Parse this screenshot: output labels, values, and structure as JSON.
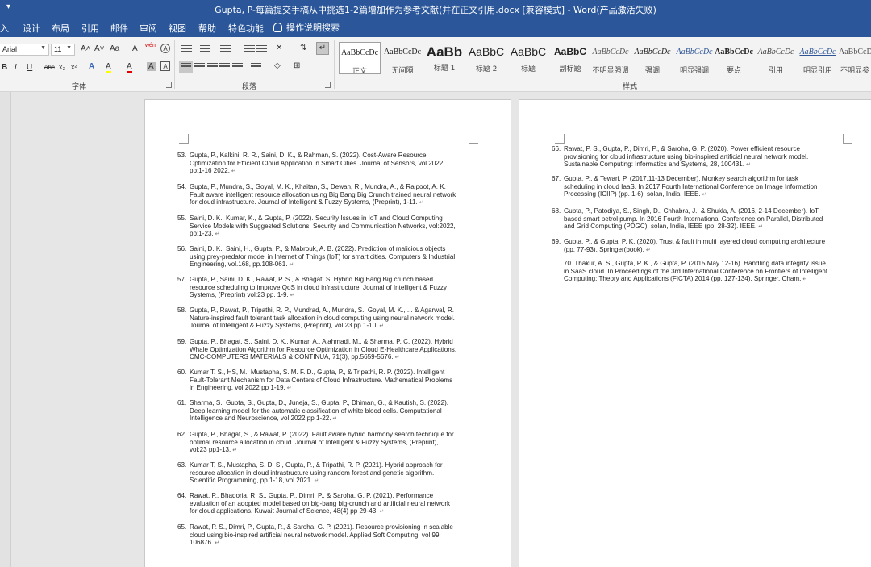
{
  "titlebar": {
    "quick_access": "▾",
    "title": "Gupta, P-每篇提交手稿从中挑选1-2篇增加作为参考文献(并在正文引用.docx [兼容模式]  -  Word(产品激活失败)"
  },
  "tabs": [
    "入",
    "设计",
    "布局",
    "引用",
    "邮件",
    "审阅",
    "视图",
    "帮助",
    "特色功能"
  ],
  "tell_me": "操作说明搜索",
  "ribbon": {
    "font_name": "Arial",
    "font_size": "11",
    "font_group_label": "字体",
    "paragraph_group_label": "段落",
    "styles_group_label": "样式",
    "font_buttons": [
      "A˄",
      "A˅",
      "Aa",
      "A",
      "wén",
      "A",
      "B",
      "I",
      "U",
      "abc",
      "x₂",
      "x²",
      "A",
      "A",
      "A",
      "A"
    ],
    "styles": [
      {
        "preview": "AaBbCcDc",
        "name": "正文"
      },
      {
        "preview": "AaBbCcDc",
        "name": "无间隔"
      },
      {
        "preview": "AaBb",
        "name": "标题 1"
      },
      {
        "preview": "AaBbC",
        "name": "标题 2"
      },
      {
        "preview": "AaBbC",
        "name": "标题"
      },
      {
        "preview": "AaBbC",
        "name": "副标题"
      },
      {
        "preview": "AaBbCcDc",
        "name": "不明显强调"
      },
      {
        "preview": "AaBbCcDc",
        "name": "强调"
      },
      {
        "preview": "AaBbCcDc",
        "name": "明显强调"
      },
      {
        "preview": "AaBbCcDc",
        "name": "要点"
      },
      {
        "preview": "AaBbCcDc",
        "name": "引用"
      },
      {
        "preview": "AaBbCcDc",
        "name": "明显引用"
      },
      {
        "preview": "AaBbCcDc",
        "name": "不明显参"
      }
    ]
  },
  "page1": {
    "refs": [
      {
        "num": "53.",
        "lines": [
          "Gupta, P., Kalkini, R. R., Saini, D. K., & Rahman, S. (2022). Cost-Aware Resource",
          "Optimization for Efficient Cloud Application in Smart Cities. Journal of Sensors, vol.2022,",
          "pp:1-16 2022."
        ]
      },
      {
        "num": "54.",
        "lines": [
          "Gupta, P., Mundra, S., Goyal, M. K., Khaitan, S., Dewan, R., Mundra, A., & Rajpoot, A. K.",
          "Fault aware intelligent resource allocation using Big Bang Big Crunch trained neural network",
          "for cloud infrastructure. Journal of Intelligent & Fuzzy Systems, (Preprint), 1-11."
        ]
      },
      {
        "num": "55.",
        "lines": [
          "Saini, D. K., Kumar, K., & Gupta, P. (2022). Security Issues in IoT and Cloud Computing",
          "Service Models with Suggested Solutions. Security and Communication Networks, vol:2022,",
          "pp:1-23."
        ]
      },
      {
        "num": "56.",
        "lines": [
          "Saini, D. K., Saini, H., Gupta, P., & Mabrouk, A. B. (2022). Prediction of malicious objects",
          "using prey-predator model in Internet of Things (IoT) for smart cities. Computers & Industrial",
          "Engineering, vol.168, pp.108-061."
        ]
      },
      {
        "num": "57.",
        "lines": [
          "Gupta, P., Saini, D. K., Rawat, P. S., & Bhagat, S. Hybrid Big Bang Big crunch based",
          "resource scheduling to improve QoS in cloud infrastructure. Journal of Intelligent & Fuzzy",
          "Systems, (Preprint) vol:23  pp. 1-9."
        ]
      },
      {
        "num": "58.",
        "lines": [
          "Gupta, P., Rawat, P., Tripathi, R. P., Mundrad, A., Mundra, S., Goyal, M. K., ... & Agarwal, R.",
          "Nature-inspired fault tolerant task allocation in cloud computing using neural network model.",
          "Journal of Intelligent & Fuzzy Systems, (Preprint), vol:23 pp.1-10."
        ]
      },
      {
        "num": "59.",
        "lines": [
          "Gupta, P., Bhagat, S., Saini, D. K., Kumar, A., Alahmadi, M., & Sharma, P. C. (2022). Hybrid",
          "Whale Optimization Algorithm for Resource Optimization in Cloud E-Healthcare Applications.",
          "CMC-COMPUTERS MATERIALS & CONTINUA, 71(3), pp.5659-5676."
        ]
      },
      {
        "num": "60.",
        "lines": [
          "Kumar T. S., HS, M., Mustapha, S. M. F. D., Gupta, P., & Tripathi, R. P. (2022). Intelligent",
          "Fault-Tolerant Mechanism for Data Centers of Cloud Infrastructure. Mathematical Problems",
          "in Engineering, vol 2022 pp 1-19."
        ]
      },
      {
        "num": "61.",
        "lines": [
          "Sharma, S., Gupta, S., Gupta, D., Juneja, S., Gupta, P., Dhiman, G., & Kautish, S. (2022).",
          "Deep learning model for the automatic classification of white blood cells. Computational",
          "Intelligence and Neuroscience, vol 2022 pp 1-22."
        ]
      },
      {
        "num": "62.",
        "lines": [
          "Gupta, P., Bhagat, S., & Rawat, P. (2022). Fault aware hybrid harmony search technique for",
          "optimal resource allocation in cloud. Journal of Intelligent & Fuzzy Systems, (Preprint),",
          "vol:23 pp1-13."
        ]
      },
      {
        "num": "63.",
        "lines": [
          "Kumar T, S., Mustapha, S. D. S., Gupta, P., & Tripathi, R. P. (2021). Hybrid approach for",
          "resource allocation in cloud infrastructure using random forest and genetic algorithm.",
          "Scientific Programming, pp.1-18, vol.2021."
        ]
      },
      {
        "num": "64.",
        "lines": [
          "Rawat, P., Bhadoria, R. S., Gupta, P., Dimri, P., & Saroha, G. P. (2021). Performance",
          "evaluation of an adopted model based on big-bang big-crunch and artificial neural network",
          "for cloud applications. Kuwait Journal of Science, 48(4) pp 29-43."
        ]
      },
      {
        "num": "65.",
        "lines": [
          "Rawat, P. S., Dimri, P., Gupta, P., & Saroha, G. P. (2021). Resource provisioning in scalable",
          "cloud using bio-inspired artificial neural network model. Applied Soft Computing, vol.99,",
          "106876."
        ]
      }
    ]
  },
  "page2": {
    "refs": [
      {
        "num": "66.",
        "lines": [
          "Rawat, P. S., Gupta, P., Dimri, P., & Saroha, G. P. (2020). Power efficient resource",
          "provisioning for cloud infrastructure using bio-inspired artificial neural network model.",
          "Sustainable Computing: Informatics and Systems, 28, 100431."
        ]
      },
      {
        "num": "67.",
        "lines": [
          "Gupta, P., & Tewari, P. (2017,11-13 December). Monkey search algorithm for task",
          "scheduling in cloud IaaS. In 2017 Fourth International Conference on Image Information",
          "Processing (ICIIP) (pp. 1-6). solan, India, IEEE."
        ]
      },
      {
        "num": "68.",
        "lines": [
          "Gupta, P., Patodiya, S., Singh, D., Chhabra, J., & Shukla, A. (2016, 2-14 December). IoT",
          "based smart petrol pump. In 2016 Fourth International Conference on Parallel, Distributed",
          "and Grid Computing (PDGC), solan, India, IEEE (pp. 28-32). IEEE."
        ]
      },
      {
        "num": "69.",
        "lines": [
          "Gupta, P., & Gupta, P. K. (2020). Trust & fault in multi layered cloud computing architecture",
          "(pp. 77-93). Springer(book)."
        ]
      },
      {
        "num": "",
        "lines": [
          "70. Thakur, A. S., Gupta, P. K., & Gupta, P. (2015 May 12-16). Handling data integrity issue",
          "in SaaS cloud. In Proceedings of the 3rd International Conference on Frontiers of Intelligent",
          "Computing: Theory and Applications (FICTA) 2014 (pp. 127-134). Springer, Cham."
        ]
      }
    ]
  }
}
